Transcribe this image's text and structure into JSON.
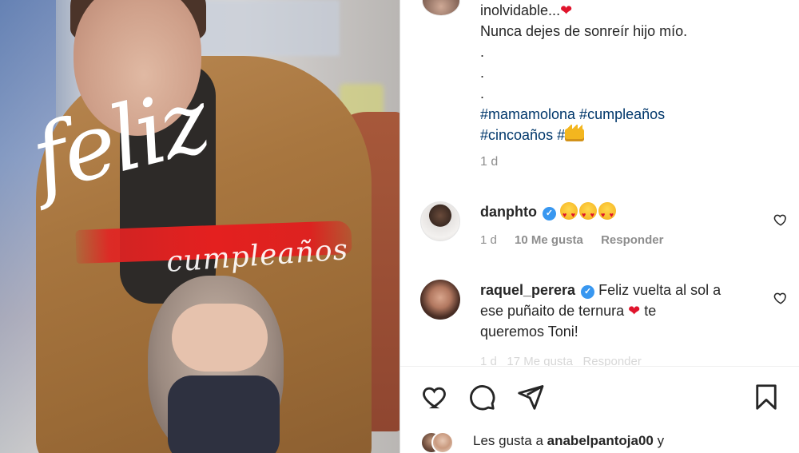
{
  "photo": {
    "overlay_word_1": "feliz",
    "overlay_word_2": "cumpleaños"
  },
  "caption": {
    "line_1": "inolvidable...",
    "line_2": "Nunca dejes de sonreír hijo mío.",
    "dots": [
      ".",
      ".",
      "."
    ],
    "hashtags_line_1": "#mamamolona #cumpleaños",
    "hashtags_line_2": "#cincoaños #",
    "time": "1 d"
  },
  "comments": [
    {
      "username": "danphto",
      "text": "",
      "emoji": [
        "heart-eyes",
        "heart-eyes",
        "heart-eyes"
      ],
      "time": "1 d",
      "likes": "10 Me gusta",
      "reply": "Responder"
    },
    {
      "username": "raquel_perera",
      "text_1": "Feliz vuelta al sol a",
      "text_2": "ese puñaito de ternura",
      "text_2b": "te",
      "text_3": "queremos Toni!",
      "time": "1 d",
      "likes": "17 Me gusta",
      "reply": "Responder"
    }
  ],
  "actions": {
    "like_icon": "heart-outline-icon",
    "comment_icon": "comment-bubble-icon",
    "share_icon": "paper-plane-icon",
    "save_icon": "bookmark-icon"
  },
  "liked_by": {
    "prefix": "Les gusta a",
    "user": "anabelpantoja00",
    "suffix": "y"
  },
  "colors": {
    "hashtag": "#00376b",
    "verified": "#3897f0",
    "heart": "#e0142c",
    "muted": "#8e8e8e"
  }
}
